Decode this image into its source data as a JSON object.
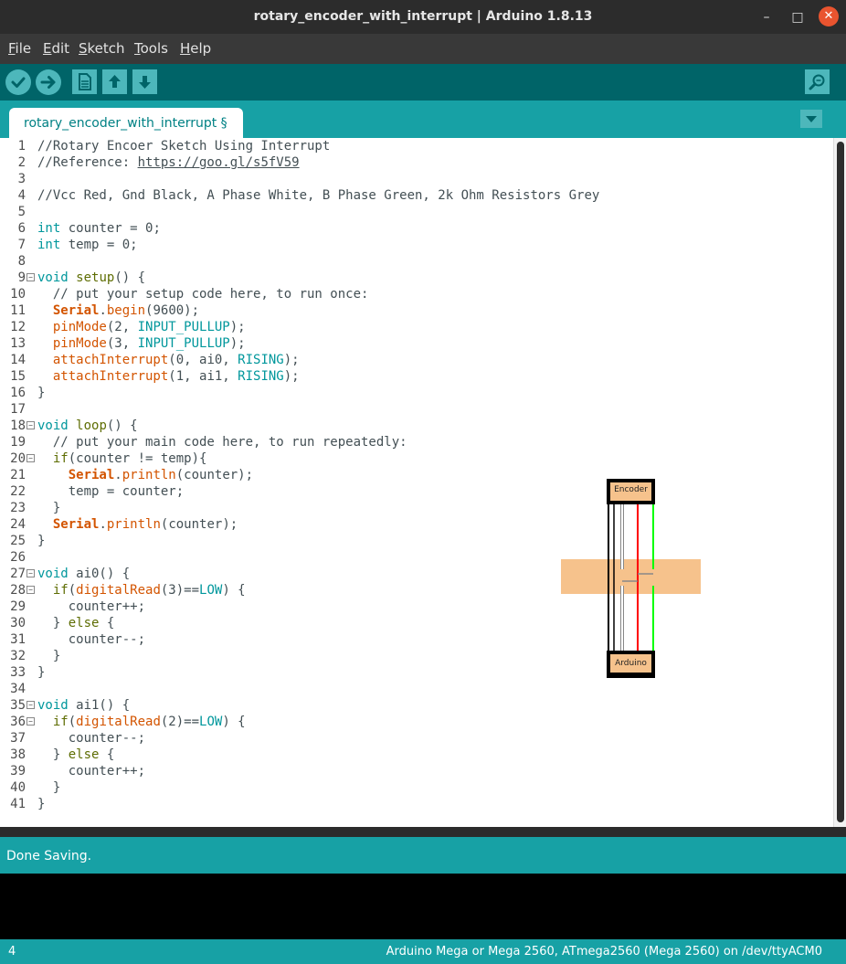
{
  "window": {
    "title": "rotary_encoder_with_interrupt | Arduino 1.8.13",
    "minimize": "–",
    "maximize": "□",
    "close": "✕"
  },
  "menu": [
    {
      "label": "File",
      "ul": "F",
      "rest": "ile"
    },
    {
      "label": "Edit",
      "ul": "E",
      "rest": "dit"
    },
    {
      "label": "Sketch",
      "ul": "S",
      "rest": "ketch"
    },
    {
      "label": "Tools",
      "ul": "T",
      "rest": "ools"
    },
    {
      "label": "Help",
      "ul": "H",
      "rest": "elp"
    }
  ],
  "toolbar": {
    "icons": [
      "verify-icon",
      "upload-icon",
      "new-icon",
      "open-icon",
      "save-icon",
      "serial-monitor-icon"
    ]
  },
  "tabs": [
    {
      "label": "rotary_encoder_with_interrupt §"
    }
  ],
  "code": [
    {
      "n": "1",
      "fold": "",
      "html": "<span class='c-comment'>//Rotary Encoer Sketch Using Interrupt</span>"
    },
    {
      "n": "2",
      "fold": "",
      "html": "<span class='c-comment'>//Reference: <span class='c-link'>https://goo.gl/s5fV59</span></span>"
    },
    {
      "n": "3",
      "fold": "",
      "html": ""
    },
    {
      "n": "4",
      "fold": "",
      "html": "<span class='c-comment'>//Vcc Red, Gnd Black, A Phase White, B Phase Green, 2k Ohm Resistors Grey</span>"
    },
    {
      "n": "5",
      "fold": "",
      "html": ""
    },
    {
      "n": "6",
      "fold": "",
      "html": "<span class='c-type'>int</span> counter = 0;"
    },
    {
      "n": "7",
      "fold": "",
      "html": "<span class='c-type'>int</span> temp = 0;"
    },
    {
      "n": "8",
      "fold": "",
      "html": ""
    },
    {
      "n": "9",
      "fold": "−",
      "html": "<span class='c-type'>void</span> <span class='c-kw'>setup</span>() {"
    },
    {
      "n": "10",
      "fold": "",
      "html": "  <span class='c-comment'>// put your setup code here, to run once:</span>"
    },
    {
      "n": "11",
      "fold": "",
      "html": "  <span class='c-bold'>Serial</span>.<span class='c-fn'>begin</span>(9600);"
    },
    {
      "n": "12",
      "fold": "",
      "html": "  <span class='c-fn'>pinMode</span>(2, <span class='c-const'>INPUT_PULLUP</span>);"
    },
    {
      "n": "13",
      "fold": "",
      "html": "  <span class='c-fn'>pinMode</span>(3, <span class='c-const'>INPUT_PULLUP</span>);"
    },
    {
      "n": "14",
      "fold": "",
      "html": "  <span class='c-fn'>attachInterrupt</span>(0, ai0, <span class='c-const'>RISING</span>);"
    },
    {
      "n": "15",
      "fold": "",
      "html": "  <span class='c-fn'>attachInterrupt</span>(1, ai1, <span class='c-const'>RISING</span>);"
    },
    {
      "n": "16",
      "fold": "",
      "html": "}"
    },
    {
      "n": "17",
      "fold": "",
      "html": ""
    },
    {
      "n": "18",
      "fold": "−",
      "html": "<span class='c-type'>void</span> <span class='c-kw'>loop</span>() {"
    },
    {
      "n": "19",
      "fold": "",
      "html": "  <span class='c-comment'>// put your main code here, to run repeatedly:</span>"
    },
    {
      "n": "20",
      "fold": "−",
      "html": "  <span class='c-kw'>if</span>(counter != temp){"
    },
    {
      "n": "21",
      "fold": "",
      "html": "    <span class='c-bold'>Serial</span>.<span class='c-fn'>println</span>(counter);"
    },
    {
      "n": "22",
      "fold": "",
      "html": "    temp = counter;"
    },
    {
      "n": "23",
      "fold": "",
      "html": "  }"
    },
    {
      "n": "24",
      "fold": "",
      "html": "  <span class='c-bold'>Serial</span>.<span class='c-fn'>println</span>(counter);"
    },
    {
      "n": "25",
      "fold": "",
      "html": "}"
    },
    {
      "n": "26",
      "fold": "",
      "html": ""
    },
    {
      "n": "27",
      "fold": "−",
      "html": "<span class='c-type'>void</span> ai0() {"
    },
    {
      "n": "28",
      "fold": "−",
      "html": "  <span class='c-kw'>if</span>(<span class='c-fn'>digitalRead</span>(3)==<span class='c-const'>LOW</span>) {"
    },
    {
      "n": "29",
      "fold": "",
      "html": "    counter++;"
    },
    {
      "n": "30",
      "fold": "",
      "html": "  } <span class='c-kw'>else</span> {"
    },
    {
      "n": "31",
      "fold": "",
      "html": "    counter--;"
    },
    {
      "n": "32",
      "fold": "",
      "html": "  }"
    },
    {
      "n": "33",
      "fold": "",
      "html": "}"
    },
    {
      "n": "34",
      "fold": "",
      "html": ""
    },
    {
      "n": "35",
      "fold": "−",
      "html": "<span class='c-type'>void</span> ai1() {"
    },
    {
      "n": "36",
      "fold": "−",
      "html": "  <span class='c-kw'>if</span>(<span class='c-fn'>digitalRead</span>(2)==<span class='c-const'>LOW</span>) {"
    },
    {
      "n": "37",
      "fold": "",
      "html": "    counter--;"
    },
    {
      "n": "38",
      "fold": "",
      "html": "  } <span class='c-kw'>else</span> {"
    },
    {
      "n": "39",
      "fold": "",
      "html": "    counter++;"
    },
    {
      "n": "40",
      "fold": "",
      "html": "  }"
    },
    {
      "n": "41",
      "fold": "",
      "html": "}"
    }
  ],
  "diagram": {
    "top_label": "Encoder",
    "bottom_label": "Arduino",
    "wire_colors": [
      "#ffffff",
      "#000000",
      "#ff0000",
      "#00ff00"
    ],
    "resistor_color": "#f6c28c"
  },
  "status": {
    "message": "Done Saving."
  },
  "footer": {
    "line": "4",
    "board": "Arduino Mega or Mega 2560, ATmega2560 (Mega 2560) on /dev/ttyACM0"
  },
  "colors": {
    "teal_dark": "#006468",
    "teal": "#17a1a5",
    "button": "#4db7bb",
    "close": "#e9542f"
  }
}
